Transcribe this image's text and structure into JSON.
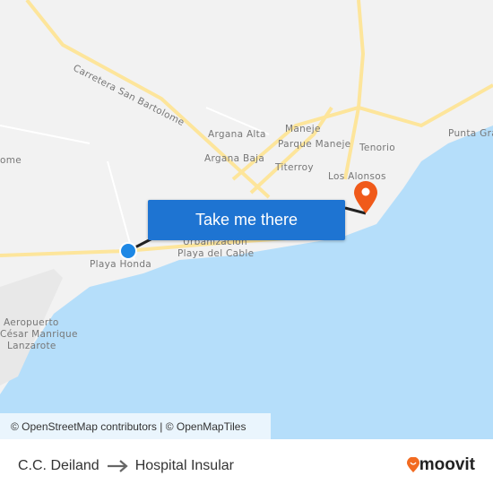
{
  "map": {
    "labels": {
      "carretera": "Carretera San Bartolome",
      "argana_alta": "Argana Alta",
      "maneje": "Maneje",
      "parque_maneje": "Parque Maneje",
      "tenorio": "Tenorio",
      "argana_baja": "Argana Baja",
      "titerroy": "Titerroy",
      "los_alonsos": "Los Alonsos",
      "punta_grande": "Punta Gra",
      "left_edge": "ome",
      "urbanizacion": "Urbanización",
      "playa_cable": "Playa del Cable",
      "playa_honda": "Playa Honda",
      "aeropuerto1": "Aeropuerto",
      "aeropuerto2": "César Manrique",
      "aeropuerto3": "Lanzarote"
    },
    "colors": {
      "water": "#b5defa",
      "land": "#f2f2f2",
      "road": "#fde59b",
      "origin": "#1e88e5",
      "destination": "#f05a1a",
      "route": "#222222"
    }
  },
  "cta": {
    "label": "Take me there"
  },
  "attribution": "© OpenStreetMap contributors | © OpenMapTiles",
  "footer": {
    "origin": "C.C. Deiland",
    "destination": "Hospital Insular",
    "brand": "moovit"
  }
}
